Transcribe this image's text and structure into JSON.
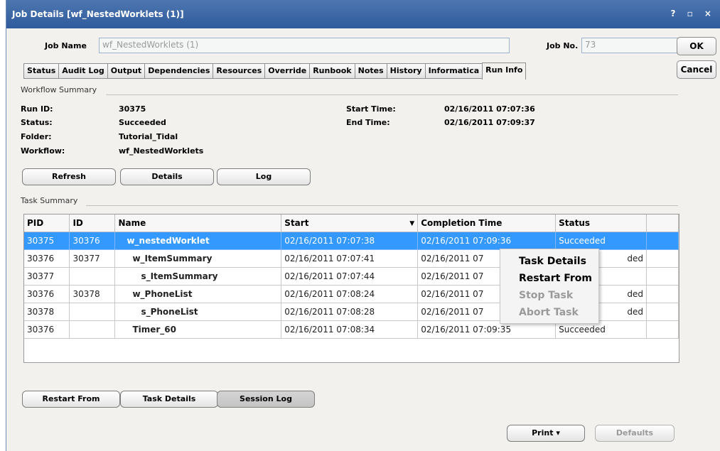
{
  "window": {
    "title": "Job Details [wf_NestedWorklets (1)]",
    "controls": "? ▫ ×"
  },
  "header": {
    "job_name_label": "Job Name",
    "job_name_value": "wf_NestedWorklets (1)",
    "job_no_label": "Job No.",
    "job_no_value": "73"
  },
  "side_buttons": {
    "ok": "OK",
    "cancel": "Cancel"
  },
  "tabs": [
    "Status",
    "Audit Log",
    "Output",
    "Dependencies",
    "Resources",
    "Override",
    "Runbook",
    "Notes",
    "History",
    "Informatica",
    "Run Info"
  ],
  "active_tab": "Run Info",
  "workflow_summary": {
    "section_label": "Workflow Summary",
    "run_id_label": "Run ID:",
    "run_id": "30375",
    "status_label": "Status:",
    "status": "Succeeded",
    "folder_label": "Folder:",
    "folder": "Tutorial_Tidal",
    "workflow_label": "Workflow:",
    "workflow": "wf_NestedWorklets",
    "start_time_label": "Start Time:",
    "start_time": "02/16/2011 07:07:36",
    "end_time_label": "End Time:",
    "end_time": "02/16/2011 07:09:37",
    "buttons": {
      "refresh": "Refresh",
      "details": "Details",
      "log": "Log"
    }
  },
  "task_summary": {
    "section_label": "Task Summary",
    "columns": [
      "PID",
      "ID",
      "Name",
      "Start",
      "Completion Time",
      "Status"
    ],
    "rows": [
      {
        "pid": "30375",
        "id": "30376",
        "name": "w_nestedWorklet",
        "start": "02/16/2011 07:07:38",
        "completion": "02/16/2011 07:09:36",
        "status": "Succeeded"
      },
      {
        "pid": "30376",
        "id": "30377",
        "name": "w_ItemSummary",
        "start": "02/16/2011 07:07:41",
        "completion": "02/16/2011 07",
        "status": "ded"
      },
      {
        "pid": "30377",
        "id": "",
        "name": "s_ItemSummary",
        "start": "02/16/2011 07:07:44",
        "completion": "02/16/2011 07",
        "status": ""
      },
      {
        "pid": "30376",
        "id": "30378",
        "name": "w_PhoneList",
        "start": "02/16/2011 07:08:24",
        "completion": "02/16/2011 07",
        "status": "ded"
      },
      {
        "pid": "30378",
        "id": "",
        "name": "s_PhoneList",
        "start": "02/16/2011 07:08:28",
        "completion": "02/16/2011 07",
        "status": "ded"
      },
      {
        "pid": "30376",
        "id": "",
        "name": "Timer_60",
        "start": "02/16/2011 07:08:34",
        "completion": "02/16/2011 07:09:35",
        "status": "Succeeded"
      }
    ],
    "buttons": {
      "restart_from": "Restart From",
      "task_details": "Task Details",
      "session_log": "Session Log"
    }
  },
  "context_menu": {
    "task_details": "Task Details",
    "restart_from": "Restart From",
    "stop_task": "Stop Task",
    "abort_task": "Abort Task"
  },
  "footer": {
    "print": "Print",
    "print_arrow": "▾",
    "defaults": "Defaults"
  },
  "colors": {
    "title_bar": "#3a66a6",
    "selection": "#3399ff",
    "panel_bg": "#f2f1ee",
    "disabled_text": "#9a9a9a"
  }
}
